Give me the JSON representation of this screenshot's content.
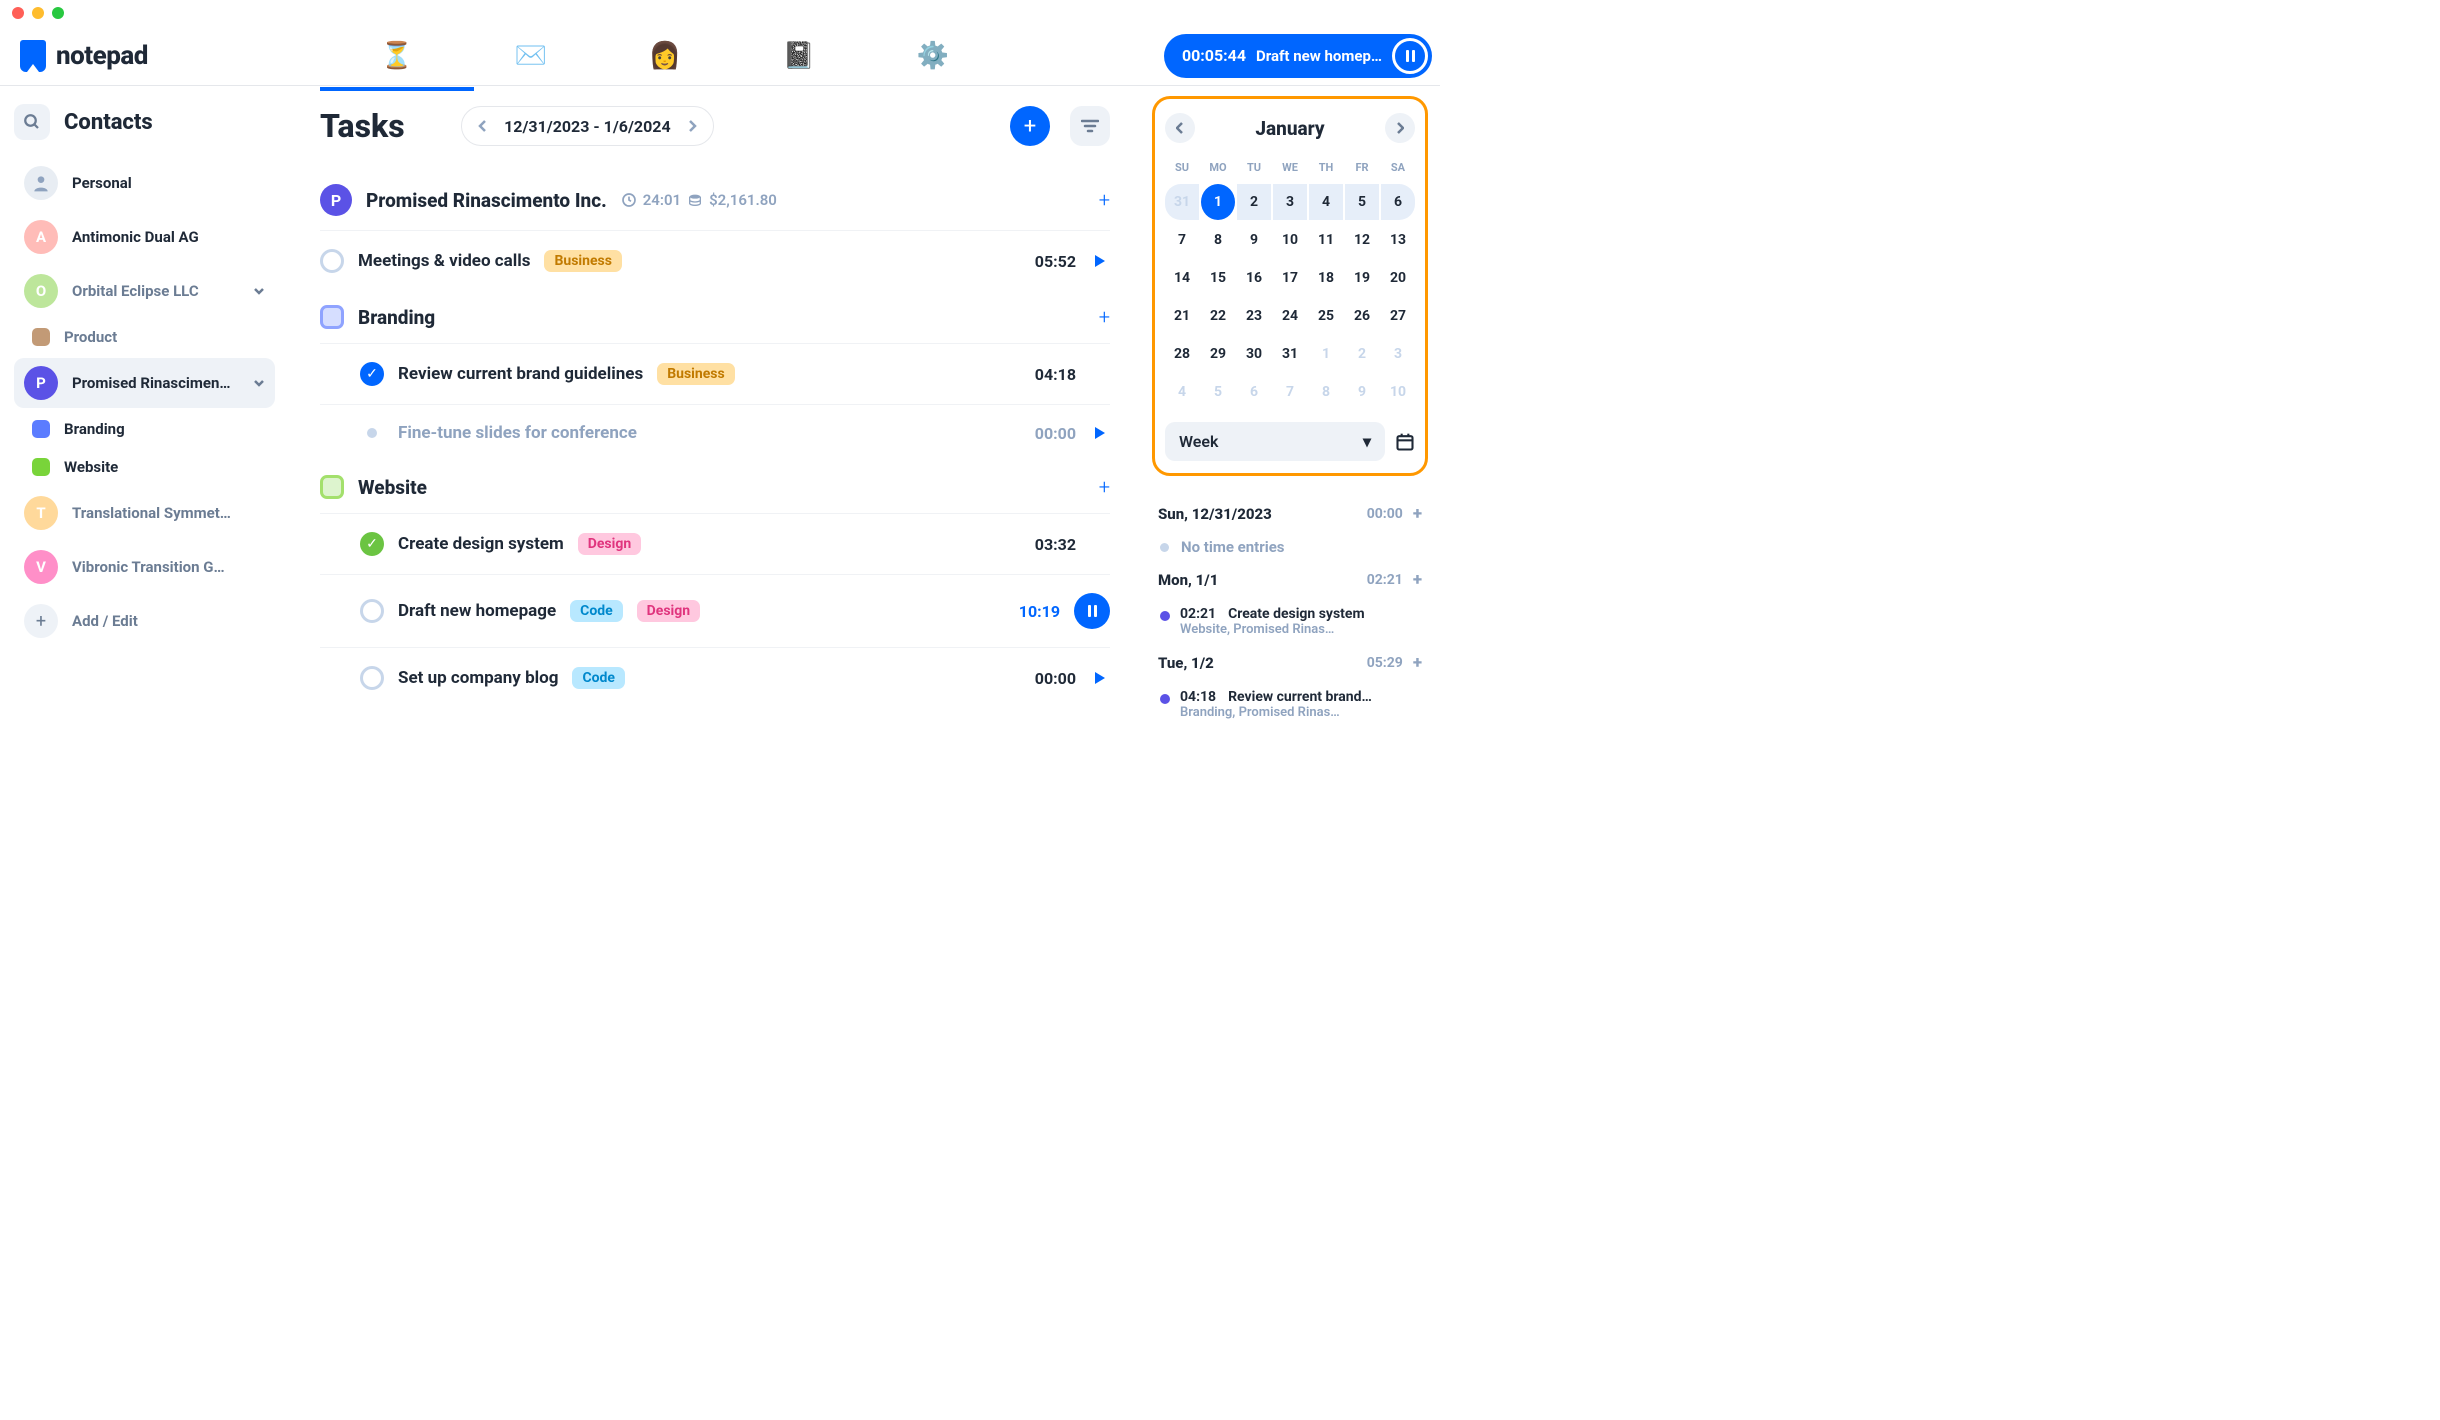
{
  "app": {
    "name": "notepad"
  },
  "timer": {
    "elapsed": "00:05:44",
    "label": "Draft new homep…"
  },
  "sidebar": {
    "title": "Contacts",
    "items": [
      {
        "label": "Personal",
        "type": "avatar-img",
        "color": "#e8edf3"
      },
      {
        "label": "Antimonic Dual AG",
        "type": "avatar",
        "initial": "A",
        "color": "#ffbcb8"
      },
      {
        "label": "Orbital Eclipse LLC",
        "type": "avatar",
        "initial": "O",
        "color": "#bde69b",
        "expand": true,
        "muted": true
      },
      {
        "label": "Product",
        "type": "square",
        "color": "#c29a76",
        "child": true,
        "muted": true
      },
      {
        "label": "Promised Rinascimen…",
        "type": "avatar",
        "initial": "P",
        "color": "#5b52e6",
        "expand": true,
        "selected": true
      },
      {
        "label": "Branding",
        "type": "square",
        "color": "#5b7cff",
        "child": true
      },
      {
        "label": "Website",
        "type": "square",
        "color": "#79d43a",
        "child": true
      },
      {
        "label": "Translational Symmet…",
        "type": "avatar",
        "initial": "T",
        "color": "#ffd99b",
        "muted": true
      },
      {
        "label": "Vibronic Transition G…",
        "type": "avatar",
        "initial": "V",
        "color": "#ff8fc8",
        "muted": true
      }
    ],
    "add_label": "Add / Edit"
  },
  "main": {
    "title": "Tasks",
    "date_range": "12/31/2023 - 1/6/2024",
    "groups": [
      {
        "type": "company",
        "label": "Promised Rinascimento Inc.",
        "initial": "P",
        "color": "#5b52e6",
        "time": "24:01",
        "money": "$2,161.80",
        "tasks": [
          {
            "name": "Meetings & video calls",
            "tags": [
              "Business"
            ],
            "time": "05:52",
            "action": "play",
            "check": "pending",
            "indent": 0
          }
        ]
      },
      {
        "type": "project",
        "label": "Branding",
        "color": "#5b7cff",
        "square_border": "#8fa3ff",
        "tasks": [
          {
            "name": "Review current brand guidelines",
            "tags": [
              "Business"
            ],
            "time": "04:18",
            "check": "done",
            "indent": 1
          },
          {
            "name": "Fine-tune slides for conference",
            "tags": [],
            "time": "00:00",
            "action": "play",
            "check": "dot",
            "muted": true,
            "indent": 1
          }
        ]
      },
      {
        "type": "project",
        "label": "Website",
        "color": "#79d43a",
        "square_border": "#a3e06c",
        "tasks": [
          {
            "name": "Create design system",
            "tags": [
              "Design"
            ],
            "time": "03:32",
            "check": "done-green",
            "indent": 1
          },
          {
            "name": "Draft new homepage",
            "tags": [
              "Code",
              "Design"
            ],
            "time": "10:19",
            "time_blue": true,
            "action": "pause",
            "check": "pending",
            "indent": 1
          },
          {
            "name": "Set up company blog",
            "tags": [
              "Code"
            ],
            "time": "00:00",
            "action": "play",
            "check": "pending",
            "indent": 1
          }
        ]
      }
    ]
  },
  "calendar": {
    "month": "January",
    "dow": [
      "SU",
      "MO",
      "TU",
      "WE",
      "TH",
      "FR",
      "SA"
    ],
    "weeks": [
      [
        {
          "d": "31",
          "muted": true,
          "hl": true
        },
        {
          "d": "1",
          "sel": true,
          "hl": true
        },
        {
          "d": "2",
          "hl": true
        },
        {
          "d": "3",
          "hl": true
        },
        {
          "d": "4",
          "hl": true
        },
        {
          "d": "5",
          "hl": true
        },
        {
          "d": "6",
          "hl": true
        }
      ],
      [
        {
          "d": "7"
        },
        {
          "d": "8"
        },
        {
          "d": "9"
        },
        {
          "d": "10"
        },
        {
          "d": "11"
        },
        {
          "d": "12"
        },
        {
          "d": "13"
        }
      ],
      [
        {
          "d": "14"
        },
        {
          "d": "15"
        },
        {
          "d": "16"
        },
        {
          "d": "17"
        },
        {
          "d": "18"
        },
        {
          "d": "19"
        },
        {
          "d": "20"
        }
      ],
      [
        {
          "d": "21"
        },
        {
          "d": "22"
        },
        {
          "d": "23"
        },
        {
          "d": "24"
        },
        {
          "d": "25"
        },
        {
          "d": "26"
        },
        {
          "d": "27"
        }
      ],
      [
        {
          "d": "28"
        },
        {
          "d": "29"
        },
        {
          "d": "30"
        },
        {
          "d": "31"
        },
        {
          "d": "1",
          "muted": true
        },
        {
          "d": "2",
          "muted": true
        },
        {
          "d": "3",
          "muted": true
        }
      ],
      [
        {
          "d": "4",
          "muted": true
        },
        {
          "d": "5",
          "muted": true
        },
        {
          "d": "6",
          "muted": true
        },
        {
          "d": "7",
          "muted": true
        },
        {
          "d": "8",
          "muted": true
        },
        {
          "d": "9",
          "muted": true
        },
        {
          "d": "10",
          "muted": true
        }
      ]
    ],
    "view": "Week"
  },
  "entries": {
    "days": [
      {
        "label": "Sun, 12/31/2023",
        "time": "00:00",
        "empty": "No time entries"
      },
      {
        "label": "Mon, 1/1",
        "time": "02:21",
        "items": [
          {
            "time": "02:21",
            "title": "Create design system",
            "sub": "Website, Promised Rinas…",
            "color": "#5b52e6"
          }
        ]
      },
      {
        "label": "Tue, 1/2",
        "time": "05:29",
        "items": [
          {
            "time": "04:18",
            "title": "Review current brand…",
            "sub": "Branding, Promised Rinas…",
            "color": "#5b52e6"
          }
        ]
      }
    ]
  }
}
